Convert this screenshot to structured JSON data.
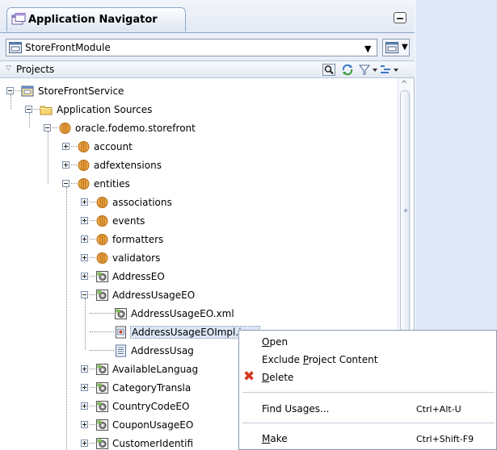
{
  "navigator": {
    "title": "Application Navigator",
    "module": "StoreFrontModule",
    "projects_label": "Projects"
  },
  "toolbar_icons": [
    "find-icon",
    "sync-icon",
    "filter-icon",
    "sort-icon"
  ],
  "tree": [
    {
      "label": "StoreFrontService",
      "icon": "project-icon"
    },
    {
      "label": "Application Sources",
      "icon": "folder-icon"
    },
    {
      "label": "oracle.fodemo.storefront",
      "icon": "package-icon"
    },
    {
      "label": "account",
      "icon": "package-icon"
    },
    {
      "label": "adfextensions",
      "icon": "package-icon"
    },
    {
      "label": "entities",
      "icon": "package-icon"
    },
    {
      "label": "associations",
      "icon": "package-icon"
    },
    {
      "label": "events",
      "icon": "package-icon"
    },
    {
      "label": "formatters",
      "icon": "package-icon"
    },
    {
      "label": "validators",
      "icon": "package-icon"
    },
    {
      "label": "AddressEO",
      "icon": "entity-icon"
    },
    {
      "label": "AddressUsageEO",
      "icon": "entity-icon"
    },
    {
      "label": "AddressUsageEO.xml",
      "icon": "entity-icon"
    },
    {
      "label": "AddressUsageEOImpl.java",
      "icon": "java-file-icon"
    },
    {
      "label": "AddressUsag",
      "icon": "text-file-icon"
    },
    {
      "label": "AvailableLanguag",
      "icon": "entity-icon"
    },
    {
      "label": "CategoryTransla",
      "icon": "entity-icon"
    },
    {
      "label": "CountryCodeEO",
      "icon": "entity-icon"
    },
    {
      "label": "CouponUsageEO",
      "icon": "entity-icon"
    },
    {
      "label": "CustomerIdentifi",
      "icon": "entity-icon"
    }
  ],
  "context_menu": {
    "open": {
      "pre": "",
      "mn": "O",
      "post": "pen"
    },
    "exclude": {
      "pre": "Exclude ",
      "mn": "P",
      "post": "roject Content"
    },
    "delete": {
      "pre": "",
      "mn": "D",
      "post": "elete"
    },
    "find_usages": {
      "pre": "Find Usa",
      "mn": "g",
      "post": "es...",
      "shortcut": "Ctrl+Alt-U"
    },
    "make": {
      "pre": "",
      "mn": "M",
      "post": "ake",
      "shortcut": "Ctrl+Shift-F9"
    }
  },
  "colors": {
    "accent": "#8ea6c8",
    "background": "#dfe8f6",
    "delete_icon": "#d63a1e"
  }
}
